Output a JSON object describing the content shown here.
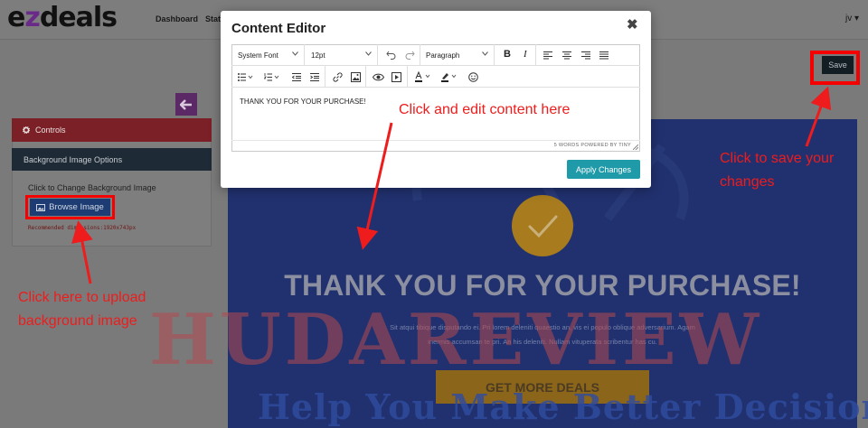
{
  "header": {
    "logo_prefix": "e",
    "logo_mid": "z",
    "logo_suffix": "deals",
    "nav": [
      "Dashboard",
      "Stati"
    ],
    "user": "jv ▾"
  },
  "left_panel": {
    "controls_label": "Controls",
    "bg_options_title": "Background Image Options",
    "change_label": "Click to Change Background Image",
    "browse_label": "Browse Image",
    "recommended": "Recommended dimensions:1920x743px"
  },
  "toolbar_main": {
    "save_label": "Save"
  },
  "modal": {
    "title": "Content Editor",
    "close": "✖",
    "font_family": "System Font",
    "font_size": "12pt",
    "block_format": "Paragraph",
    "content": "THANK YOU FOR YOUR PURCHASE!",
    "status": "5 WORDS  POWERED BY TINY",
    "apply_label": "Apply Changes"
  },
  "preview": {
    "title": "THANK YOU FOR YOUR PURCHASE!",
    "body_line1": "Sit atqui tibique disputando ei. Pri lorem deleniti quaestio an, vis ei populo oblique adversarium. Agam",
    "body_line2": "inermis accumsan te pri. An his deleniti. Nullam vituperata scribentur has cu.",
    "cta": "GET MORE DEALS"
  },
  "watermark": {
    "line1": "HUDAREVIEW",
    "line2": "Help You Make Better Decisions"
  },
  "annotations": {
    "edit_note": "Click and edit content here",
    "save_note_1": "Click to save your",
    "save_note_2": "changes",
    "upload_note_1": "Click here to upload",
    "upload_note_2": "background image"
  },
  "colors": {
    "overlay_gray": "#7a7a7a",
    "annotation_red": "#ee1c1c",
    "apply_teal": "#1f9aa8",
    "preview_blue": "#21316f",
    "cta_gold": "#8b651a"
  }
}
